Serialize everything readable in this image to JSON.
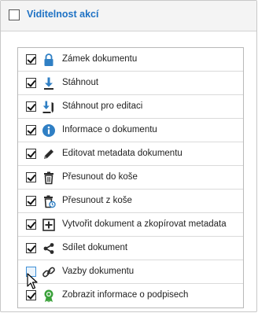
{
  "panel": {
    "title": "Viditelnost akcí",
    "header_checked": false
  },
  "actions": [
    {
      "label": "Zámek dokumentu",
      "checked": true,
      "icon": "lock-icon"
    },
    {
      "label": "Stáhnout",
      "checked": true,
      "icon": "download-icon"
    },
    {
      "label": "Stáhnout pro editaci",
      "checked": true,
      "icon": "download-edit-icon"
    },
    {
      "label": "Informace o dokumentu",
      "checked": true,
      "icon": "info-icon"
    },
    {
      "label": "Editovat metadata dokumentu",
      "checked": true,
      "icon": "pencil-icon"
    },
    {
      "label": "Přesunout do koše",
      "checked": true,
      "icon": "trash-icon"
    },
    {
      "label": "Přesunout z koše",
      "checked": true,
      "icon": "trash-restore-icon"
    },
    {
      "label": "Vytvořit dokument a zkopírovat metadata",
      "checked": true,
      "icon": "create-copy-icon"
    },
    {
      "label": "Sdílet dokument",
      "checked": true,
      "icon": "share-icon"
    },
    {
      "label": "Vazby dokumentu",
      "checked": false,
      "icon": "link-icon"
    },
    {
      "label": "Zobrazit informace o podpisech",
      "checked": true,
      "icon": "award-icon"
    }
  ],
  "colors": {
    "title": "#1f72c4",
    "icon_blue": "#2f7fc4",
    "icon_dark": "#2b2b2b",
    "award_green": "#3aa13a"
  }
}
